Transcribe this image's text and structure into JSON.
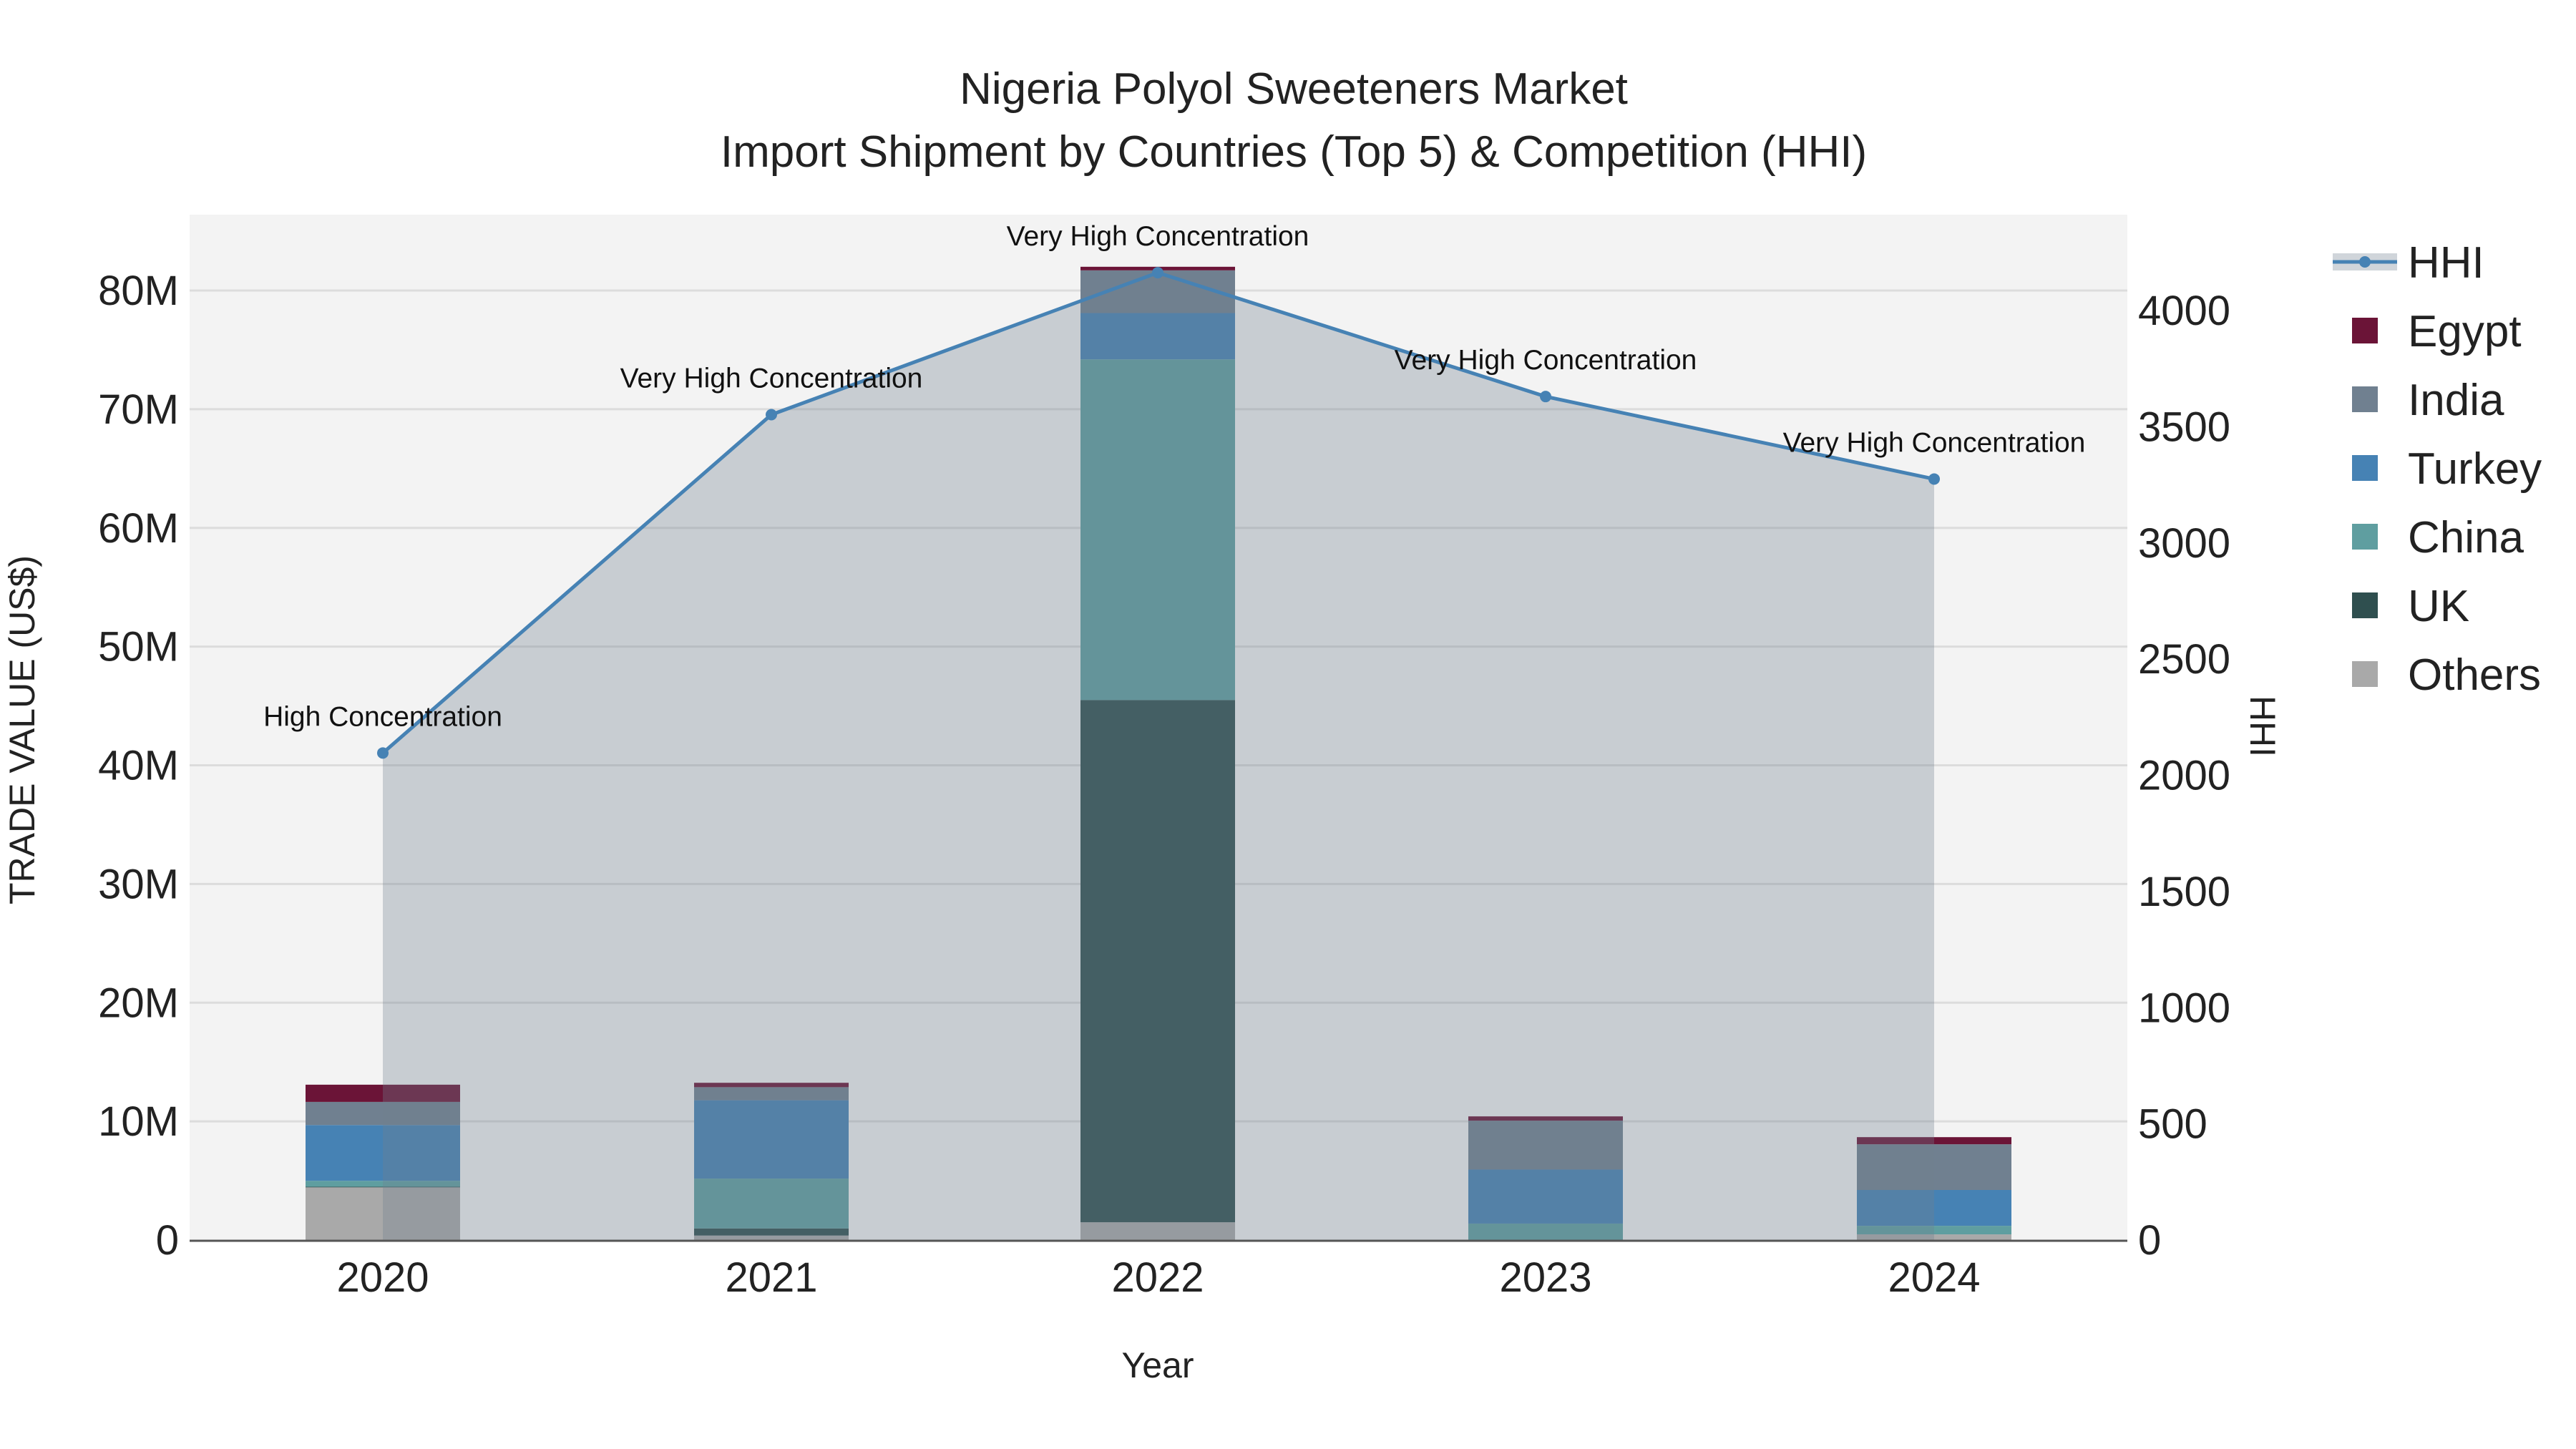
{
  "chart_data": {
    "type": "bar",
    "title_line1": "Nigeria Polyol Sweeteners Market",
    "title_line2": "Import Shipment by Countries (Top 5) & Competition (HHI)",
    "xlabel": "Year",
    "ylabel": "TRADE VALUE (US$)",
    "y2label": "HHI",
    "categories": [
      "2020",
      "2021",
      "2022",
      "2023",
      "2024"
    ],
    "ylim": [
      0,
      86
    ],
    "y_unit": "M",
    "yticks": [
      0,
      10,
      20,
      30,
      40,
      50,
      60,
      70,
      80
    ],
    "ytick_labels": [
      "0",
      "10M",
      "20M",
      "30M",
      "40M",
      "50M",
      "60M",
      "70M",
      "80M"
    ],
    "y2lim": [
      0,
      4400
    ],
    "y2ticks": [
      0,
      500,
      1000,
      1500,
      2000,
      2500,
      3000,
      3500,
      4000
    ],
    "y2tick_labels": [
      "0",
      "500",
      "1000",
      "1500",
      "2000",
      "2500",
      "3000",
      "3500",
      "4000"
    ],
    "series": [
      {
        "name": "Others",
        "color": "#a9a9a9",
        "values": [
          4.44,
          0.38,
          1.5,
          0.02,
          0.48
        ]
      },
      {
        "name": "UK",
        "color": "#2f4f4f",
        "values": [
          0.05,
          0.6,
          44.0,
          0.0,
          0.0
        ]
      },
      {
        "name": "China",
        "color": "#5f9ea0",
        "values": [
          0.5,
          4.2,
          28.7,
          1.37,
          0.72
        ]
      },
      {
        "name": "Turkey",
        "color": "#4682b4",
        "values": [
          4.7,
          6.6,
          3.9,
          4.55,
          3.02
        ]
      },
      {
        "name": "India",
        "color": "#708090",
        "values": [
          1.95,
          1.1,
          3.6,
          4.12,
          3.85
        ]
      },
      {
        "name": "Egypt",
        "color": "#6b1437",
        "values": [
          1.45,
          0.37,
          0.3,
          0.36,
          0.6
        ]
      }
    ],
    "hhi": {
      "name": "HHI",
      "color": "#4682b4",
      "values": [
        2096,
        3552,
        4163,
        3630,
        3275
      ],
      "annotations": [
        "High Concentration",
        "Very High Concentration",
        "Very High Concentration",
        "Very High Concentration",
        "Very High Concentration"
      ]
    },
    "legend": [
      "HHI",
      "Egypt",
      "India",
      "Turkey",
      "China",
      "UK",
      "Others"
    ],
    "legend_placement": "right",
    "grid": true
  }
}
